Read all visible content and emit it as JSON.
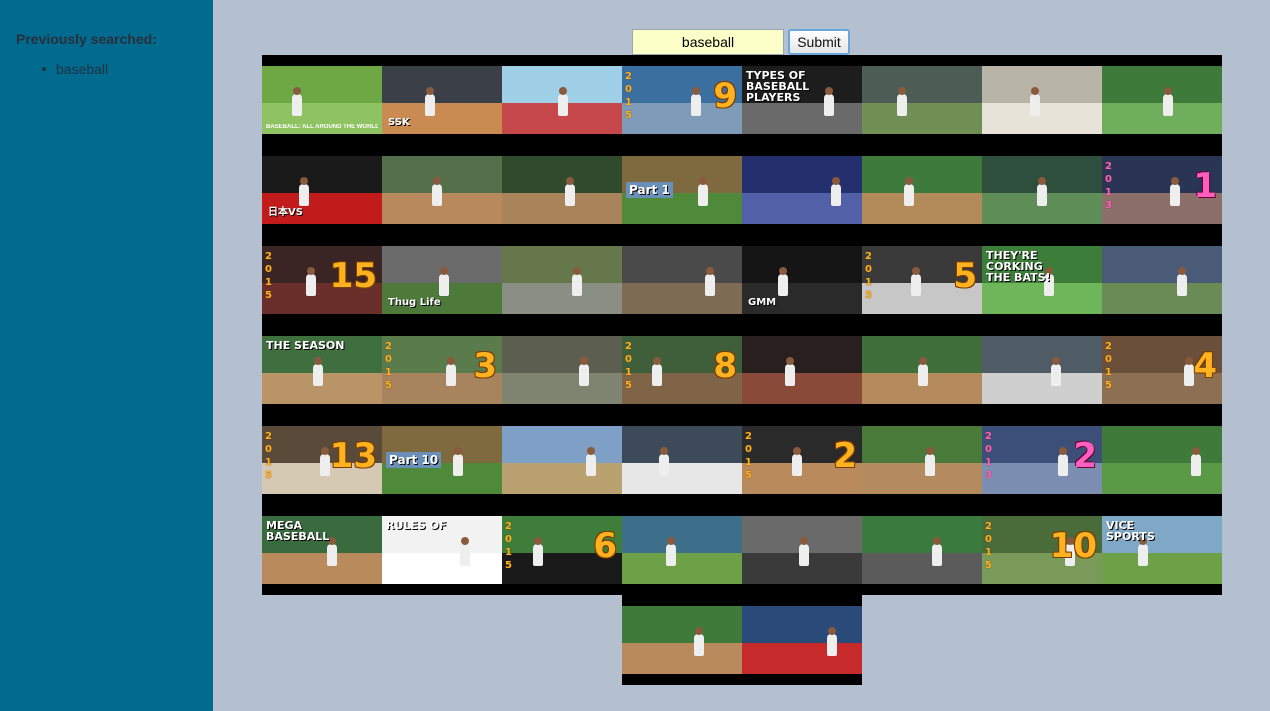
{
  "sidebar": {
    "heading": "Previously searched:",
    "history": [
      "baseball"
    ]
  },
  "search": {
    "value": "baseball",
    "submit_label": "Submit"
  },
  "results": {
    "rows": [
      [
        {
          "bg": "#6da844",
          "field": "#8fc262",
          "caption": "BASEBALL: ALL AROUND THE WORLD"
        },
        {
          "bg": "#3a3f48",
          "field": "#c98b52",
          "text": "SSK"
        },
        {
          "bg": "#9fd0e8",
          "field": "#c6484a"
        },
        {
          "bg": "#3a6fa0",
          "field": "#7e9bb7",
          "year": "2015",
          "num": "9"
        },
        {
          "bg": "#1d1d1d",
          "field": "#6a6a6a",
          "title": "TYPES OF BASEBALL PLAYERS"
        },
        {
          "bg": "#4c5d55",
          "field": "#6f8f54"
        },
        {
          "bg": "#b8b4a8",
          "field": "#e8e3d8"
        },
        {
          "bg": "#3e7a3a",
          "field": "#6fae5b"
        }
      ],
      [
        {
          "bg": "#1a1a1a",
          "field": "#c21b1b",
          "text": "日本VS"
        },
        {
          "bg": "#54704a",
          "field": "#b8895c"
        },
        {
          "bg": "#2f4a2c",
          "field": "#a9835a"
        },
        {
          "bg": "#7e6a3e",
          "field": "#4f8a3a",
          "part": "Part 1"
        },
        {
          "bg": "#24306e",
          "field": "#5260a8"
        },
        {
          "bg": "#3f7a3d",
          "field": "#b38a5a"
        },
        {
          "bg": "#2e4f3d",
          "field": "#5f8d57"
        },
        {
          "bg": "#2a3455",
          "field": "#8b6f68",
          "year": "2013",
          "num": "1",
          "pink": true
        }
      ],
      [
        {
          "bg": "#3a2524",
          "field": "#6a2f2a",
          "year": "2015",
          "num": "15"
        },
        {
          "bg": "#6b6b6b",
          "field": "#4d7a3a",
          "text": "Thug Life"
        },
        {
          "bg": "#66774b",
          "field": "#8b8f83"
        },
        {
          "bg": "#4a4a4a",
          "field": "#7d6b54"
        },
        {
          "bg": "#151515",
          "field": "#2a2a2a",
          "text": "GMM"
        },
        {
          "bg": "#3a3a3a",
          "field": "#c7c7c7",
          "year": "2015",
          "num": "5"
        },
        {
          "bg": "#3d7d3a",
          "field": "#6fb55a",
          "title": "THEY'RE CORKING THE BATS!"
        },
        {
          "bg": "#4a5b78",
          "field": "#6a8b56"
        }
      ],
      [
        {
          "bg": "#3f6f3f",
          "field": "#b89466",
          "title": "THE SEASON"
        },
        {
          "bg": "#5a7b4c",
          "field": "#a7845d",
          "year": "2015",
          "num": "3"
        },
        {
          "bg": "#5c5f4f",
          "field": "#7e8470"
        },
        {
          "bg": "#3f5f3a",
          "field": "#7f6447",
          "year": "2015",
          "num": "8"
        },
        {
          "bg": "#2a1f1f",
          "field": "#8a4a3a"
        },
        {
          "bg": "#3f6e3a",
          "field": "#b58a5d"
        },
        {
          "bg": "#4f5c66",
          "field": "#cfcfcf"
        },
        {
          "bg": "#6a4f3a",
          "field": "#8d6f52",
          "year": "2015",
          "num": "4"
        }
      ],
      [
        {
          "bg": "#5a4a3a",
          "field": "#d6c9b4",
          "year": "2015",
          "num": "13"
        },
        {
          "bg": "#7e6a3e",
          "field": "#4f8a3a",
          "part": "Part 10"
        },
        {
          "bg": "#7fa0c6",
          "field": "#b9a170"
        },
        {
          "bg": "#3c4a5a",
          "field": "#e7e7e7"
        },
        {
          "bg": "#2a2a2a",
          "field": "#b88a5c",
          "year": "2015",
          "num": "2"
        },
        {
          "bg": "#4a7a3a",
          "field": "#b48a5f"
        },
        {
          "bg": "#3c4f78",
          "field": "#7c8fb2",
          "year": "2013",
          "num": "2",
          "pink": true
        },
        {
          "bg": "#3f7a3a",
          "field": "#5a9a47"
        }
      ],
      [
        {
          "bg": "#3a6b3f",
          "field": "#b88a5c",
          "title": "MEGA BASEBALL"
        },
        {
          "bg": "#f2f2f2",
          "field": "#ffffff",
          "title": "RULES OF"
        },
        {
          "bg": "#3e7d3a",
          "field": "#1a1a1a",
          "year": "2015",
          "num": "6"
        },
        {
          "bg": "#3d6e8a",
          "field": "#6ea047"
        },
        {
          "bg": "#6a6a6a",
          "field": "#3a3a3a"
        },
        {
          "bg": "#3b7a3f",
          "field": "#5b5b5b"
        },
        {
          "bg": "#4a6b3a",
          "field": "#7a9a5a",
          "year": "2015",
          "num": "10"
        },
        {
          "bg": "#7fa8c6",
          "field": "#6ea047",
          "title": "VICE SPORTS"
        }
      ],
      [
        {
          "bg": "#3f7a3a",
          "field": "#b88a5c"
        },
        {
          "bg": "#2a4a7a",
          "field": "#c62a2a"
        }
      ]
    ]
  }
}
